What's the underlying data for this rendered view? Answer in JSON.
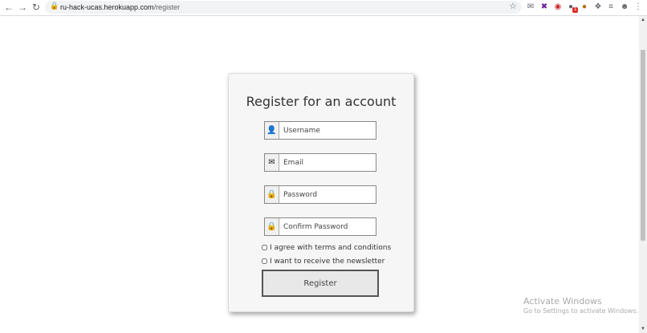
{
  "browser": {
    "url_host": "ru-hack-ucas.herokuapp.com",
    "url_path": "/register"
  },
  "form": {
    "title": "Register for an account",
    "username_placeholder": "Username",
    "email_placeholder": "Email",
    "password_placeholder": "Password",
    "confirm_password_placeholder": "Confirm Password",
    "terms_label": "I agree with terms and conditions",
    "newsletter_label": "I want to receive the newsletter",
    "submit_label": "Register"
  },
  "extensions": {
    "badge_count": "1"
  },
  "watermark": {
    "title": "Activate Windows",
    "subtitle": "Go to Settings to activate Windows."
  }
}
